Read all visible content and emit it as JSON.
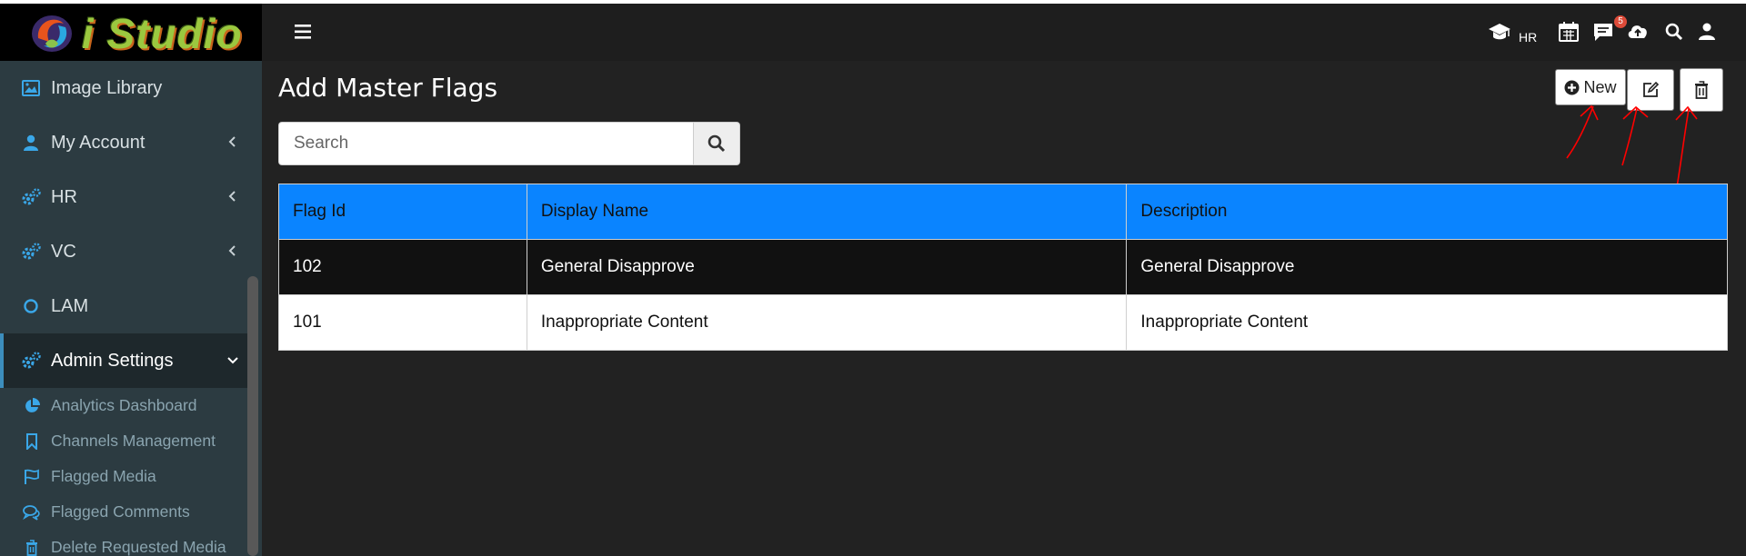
{
  "app": {
    "name": "i Studio"
  },
  "sidebar": {
    "items": [
      {
        "label": "Image Library",
        "icon": "image-icon"
      },
      {
        "label": "My Account",
        "icon": "user-icon"
      },
      {
        "label": "HR",
        "icon": "cogs-icon"
      },
      {
        "label": "VC",
        "icon": "cogs-icon"
      },
      {
        "label": "LAM",
        "icon": "circle-icon"
      },
      {
        "label": "Admin Settings",
        "icon": "cogs-icon"
      }
    ],
    "subitems": [
      {
        "label": "Analytics Dashboard",
        "icon": "pie-chart-icon"
      },
      {
        "label": "Channels Management",
        "icon": "bookmark-icon"
      },
      {
        "label": "Flagged Media",
        "icon": "flag-icon"
      },
      {
        "label": "Flagged Comments",
        "icon": "comments-icon"
      },
      {
        "label": "Delete Requested Media",
        "icon": "trash-icon"
      }
    ]
  },
  "header": {
    "hr_label": "HR",
    "notification_count": "5"
  },
  "page": {
    "title": "Add Master Flags",
    "search_placeholder": "Search",
    "new_button": "New"
  },
  "table": {
    "columns": [
      "Flag Id",
      "Display Name",
      "Description"
    ],
    "rows": [
      {
        "id": "102",
        "display_name": "General Disapprove",
        "description": "General Disapprove"
      },
      {
        "id": "101",
        "display_name": "Inappropriate Content",
        "description": "Inappropriate Content"
      }
    ]
  },
  "colors": {
    "accent": "#0a84ff",
    "sidebar_icon": "#3aa7e8",
    "badge": "#dd4b39",
    "annotation": "#ff0000"
  }
}
